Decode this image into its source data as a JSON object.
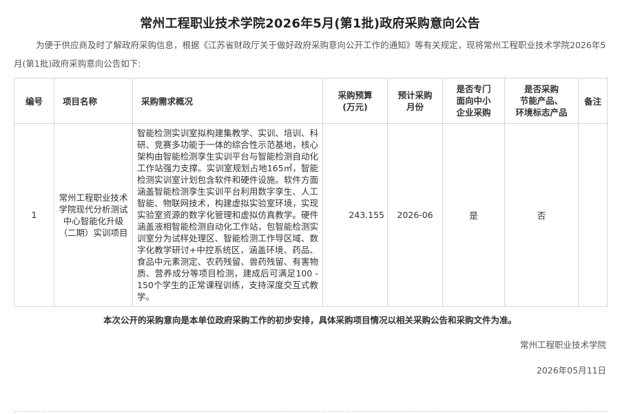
{
  "notice": {
    "title": "常州工程职业技术学院2026年5月(第1批)政府采购意向公告",
    "intro": "为便于供应商及时了解政府采购信息，根据《江苏省财政厅关于做好政府采购意向公开工作的通知》等有关规定，现将常州工程职业技术学院2026年5月(第1批)政府采购意向公告如下:",
    "footnote": "本次公开的采购意向是本单位政府采购工作的初步安排，具体采购项目情况以相关采购公告和采购文件为准。",
    "signer": "常州工程职业技术学院",
    "date": "2026年05月11日"
  },
  "table": {
    "headers": {
      "no": "编号",
      "name": "项目名称",
      "desc": "采购需求概况",
      "budget_1": "采购预算",
      "budget_2": "(万元)",
      "month_1": "预计采购",
      "month_2": "月份",
      "sme_1": "是否专门",
      "sme_2": "面向中小",
      "sme_3": "企业采购",
      "green_1": "是否采购",
      "green_2": "节能产品、",
      "green_3": "环境标志产品",
      "remark": "备注"
    },
    "rows": [
      {
        "no": "1",
        "name": "常州工程职业技术学院现代分析测试中心智能化升级（二期）实训项目",
        "desc": "智能检测实训室拟构建集教学、实训、培训、科研、竞赛多功能于一体的综合性示范基地，核心架构由智能检测孪生实训平台与智能检测自动化工作站强力支撑。实训室规划占地165㎡，智能检测实训室计划包含软件和硬件设施。软件方面涵盖智能检测孪生实训平台利用数字孪生、人工智能、物联网技术，构建虚拟实验室环境，实现实验室资源的数字化管理和虚拟仿真教学。硬件涵盖液相智能检测自动化工作站，包智能检测实训室分为试样处理区、智能检测工作导区域、数字化教学研讨+中控系统区，涵盖环境、药品、食品中元素测定、农药残留、兽药残留、有害物质、营养成分等项目检测，建成后可满足100 - 150个学生的正常课程训练，支持深度交互式教学。",
        "budget": "243.155",
        "month": "2026-06",
        "sme": "是",
        "green": "否",
        "remark": ""
      }
    ]
  }
}
